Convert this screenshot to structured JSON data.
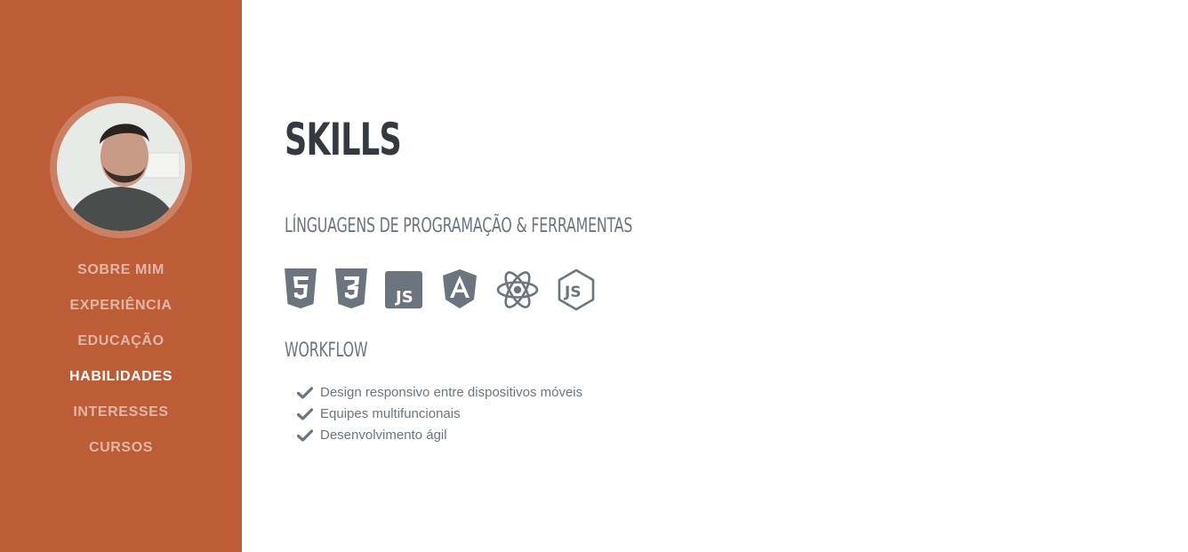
{
  "sidebar": {
    "nav": [
      {
        "label": "SOBRE MIM",
        "active": false
      },
      {
        "label": "EXPERIÊNCIA",
        "active": false
      },
      {
        "label": "EDUCAÇÃO",
        "active": false
      },
      {
        "label": "HABILIDADES",
        "active": true
      },
      {
        "label": "INTERESSES",
        "active": false
      },
      {
        "label": "CURSOS",
        "active": false
      }
    ]
  },
  "main": {
    "title": "SKILLS",
    "languages_heading": "LÍNGUAGENS DE PROGRAMAÇÃO & FERRAMENTAS",
    "icons": [
      "html5-icon",
      "css3-icon",
      "javascript-icon",
      "angular-icon",
      "react-icon",
      "nodejs-icon"
    ],
    "workflow_heading": "WORKFLOW",
    "workflow_items": [
      "Design responsivo entre dispositivos móveis",
      "Equipes multifuncionais",
      "Desenvolvimento ágil"
    ]
  },
  "colors": {
    "sidebar": "#bd5d38",
    "heading": "#343a40",
    "muted": "#6c757d"
  }
}
